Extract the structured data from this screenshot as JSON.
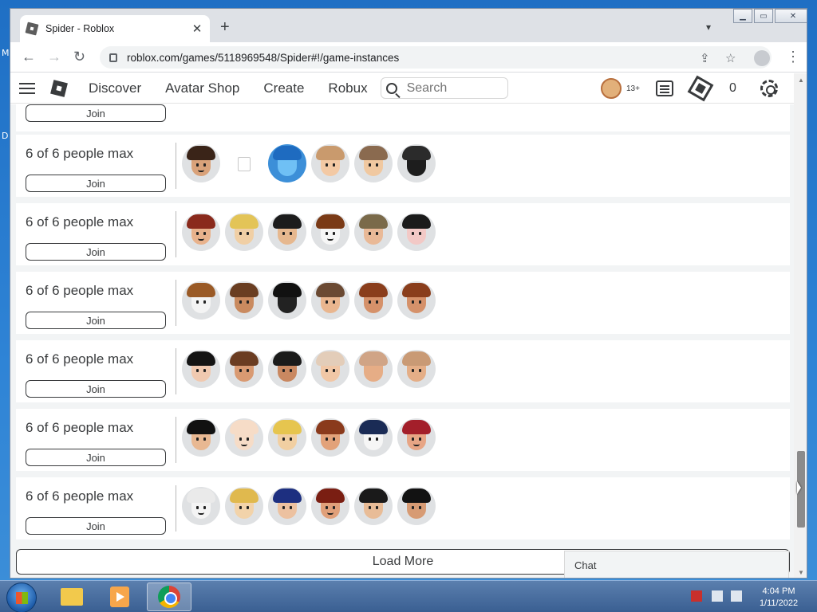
{
  "browser": {
    "tab_title": "Spider - Roblox",
    "url": "roblox.com/games/5118969548/Spider#!/game-instances"
  },
  "nav": {
    "links": [
      "Discover",
      "Avatar Shop",
      "Create",
      "Robux"
    ],
    "search_placeholder": "Search",
    "age_label": "13+",
    "robux_count": "0"
  },
  "servers": {
    "partial_join_label": "Join",
    "join_label": "Join",
    "items": [
      {
        "capacity": "6 of 6 people max"
      },
      {
        "capacity": "6 of 6 people max"
      },
      {
        "capacity": "6 of 6 people max"
      },
      {
        "capacity": "6 of 6 people max"
      },
      {
        "capacity": "6 of 6 people max"
      },
      {
        "capacity": "6 of 6 people max"
      }
    ]
  },
  "load_more_label": "Load More",
  "chat_label": "Chat",
  "taskbar": {
    "time": "4:04 PM",
    "date": "1/11/2022"
  },
  "desktop": {
    "edge_letters": [
      "M",
      "D"
    ]
  },
  "colors": {
    "text": "#393b3d",
    "page_bg": "#f2f4f5"
  }
}
